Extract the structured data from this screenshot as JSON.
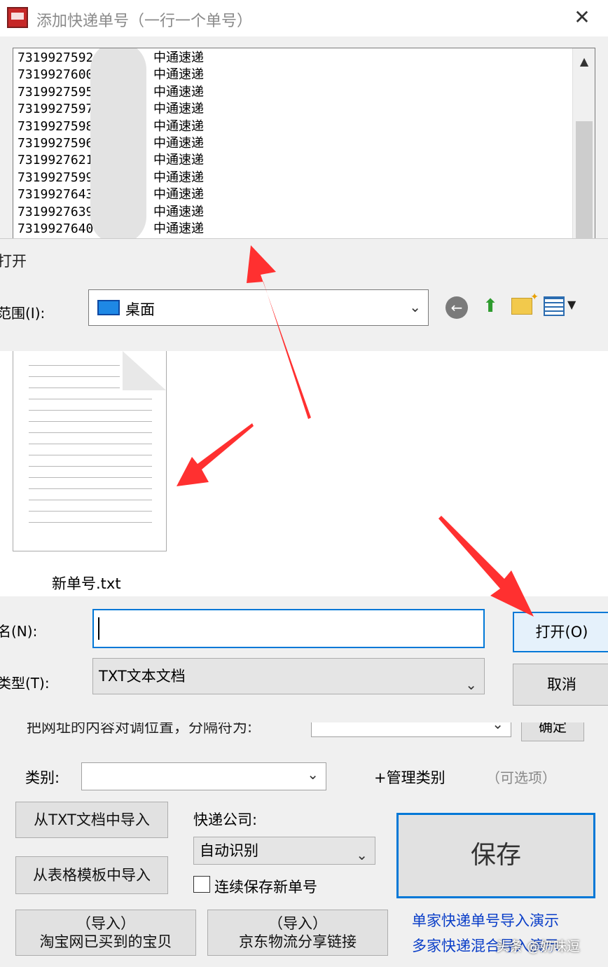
{
  "main_window": {
    "title": "添加快递单号（一行一个单号）",
    "close_glyph": "✕",
    "tracking_list": [
      {
        "number": "7319927592",
        "courier": "中通速递"
      },
      {
        "number": "7319927600",
        "courier": "中通速递"
      },
      {
        "number": "7319927595",
        "courier": "中通速递"
      },
      {
        "number": "7319927597",
        "courier": "中通速递"
      },
      {
        "number": "7319927598",
        "courier": "中通速递"
      },
      {
        "number": "7319927596",
        "courier": "中通速递"
      },
      {
        "number": "7319927621",
        "courier": "中通速递"
      },
      {
        "number": "7319927599",
        "courier": "中通速递"
      },
      {
        "number": "7319927643",
        "courier": "中通速递"
      },
      {
        "number": "7319927639",
        "courier": "中通速递"
      },
      {
        "number": "7319927640",
        "courier": "中通速递"
      }
    ],
    "separator_label": "把网址的内容对调位置，分隔符为:",
    "confirm_label": "确定",
    "category_label": "类别:",
    "manage_category_label": "+管理类别",
    "optional_hint": "（可选项）",
    "import_txt_label": "从TXT文档中导入",
    "import_template_label": "从表格模板中导入",
    "taobao_line1": "（导入）",
    "taobao_line2": "淘宝网已买到的宝贝",
    "jd_line1": "（导入）",
    "jd_line2": "京东物流分享链接",
    "courier_label": "快递公司:",
    "courier_value": "自动识别",
    "continuous_save_label": "连续保存新单号",
    "save_label": "保存",
    "demo_link_1": "单家快递单号导入演示",
    "demo_link_2": "多家快递混合导入演示",
    "watermark": "头条 @奶味逗"
  },
  "open_dialog": {
    "title": "打开",
    "lookin_label": "范围(I):",
    "lookin_value": "桌面",
    "file_name": "新单号.txt",
    "filename_label": "名(N):",
    "filename_value": "",
    "filetype_label": "类型(T):",
    "filetype_value": "TXT文本文档",
    "open_label": "打开(O)",
    "cancel_label": "取消"
  },
  "colors": {
    "accent": "#0078d7",
    "link": "#0a3ec8",
    "arrow": "#ff3030"
  }
}
